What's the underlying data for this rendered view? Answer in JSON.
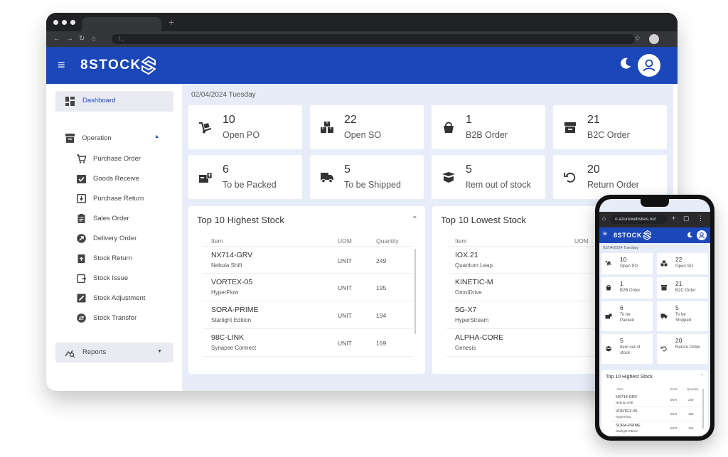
{
  "browser": {
    "url": "/..."
  },
  "app": {
    "brand": "8STOCK"
  },
  "sidebar": {
    "dashboard": "Dashboard",
    "operation": "Operation",
    "items": [
      {
        "label": "Purchase Order"
      },
      {
        "label": "Goods Receive"
      },
      {
        "label": "Purchase Return"
      },
      {
        "label": "Sales Order"
      },
      {
        "label": "Delivery Order"
      },
      {
        "label": "Stock Return"
      },
      {
        "label": "Stock Issue"
      },
      {
        "label": "Stock Adjustment"
      },
      {
        "label": "Stock Transfer"
      }
    ],
    "reports": "Reports"
  },
  "dashboard": {
    "date": "02/04/2024 Tuesday",
    "cards": [
      {
        "value": "10",
        "label": "Open PO"
      },
      {
        "value": "22",
        "label": "Open SO"
      },
      {
        "value": "1",
        "label": "B2B Order"
      },
      {
        "value": "21",
        "label": "B2C Order"
      },
      {
        "value": "6",
        "label": "To be Packed"
      },
      {
        "value": "5",
        "label": "To be Shipped"
      },
      {
        "value": "5",
        "label": "Item out of stock"
      },
      {
        "value": "20",
        "label": "Return Order"
      }
    ],
    "highest": {
      "title": "Top 10 Highest Stock",
      "headers": {
        "item": "Item",
        "uom": "UOM",
        "qty": "Quantity"
      },
      "rows": [
        {
          "item": "NX714-GRV",
          "sub": "Nebula Shift",
          "uom": "UNIT",
          "qty": "249"
        },
        {
          "item": "VORTEX-05",
          "sub": "HyperFlow",
          "uom": "UNIT",
          "qty": "195"
        },
        {
          "item": "SORA-PRIME",
          "sub": "Starlight Edition",
          "uom": "UNIT",
          "qty": "194"
        },
        {
          "item": "98C-LINK",
          "sub": "Synapse Connect",
          "uom": "UNIT",
          "qty": "169"
        }
      ]
    },
    "lowest": {
      "title": "Top 10 Lowest Stock",
      "headers": {
        "item": "Item",
        "uom": "UOM"
      },
      "rows": [
        {
          "item": "IOX.21",
          "sub": "Quantum Leap"
        },
        {
          "item": "KINETIC-M",
          "sub": "OmniDrive"
        },
        {
          "item": "5G-X7",
          "sub": "HyperStream"
        },
        {
          "item": "ALPHA-CORE",
          "sub": "Genesis"
        }
      ]
    }
  },
  "phone": {
    "url": "o.azurewebsites.net",
    "cards": [
      {
        "value": "10",
        "label": "Open PO"
      },
      {
        "value": "22",
        "label": "Open SO"
      },
      {
        "value": "1",
        "label": "B2B Order"
      },
      {
        "value": "21",
        "label": "B2C Order"
      },
      {
        "value": "6",
        "label": "To be Packed"
      },
      {
        "value": "5",
        "label": "To be Shipped"
      },
      {
        "value": "5",
        "label": "Item out of stock"
      },
      {
        "value": "20",
        "label": "Return Order"
      }
    ],
    "highest_rows": [
      {
        "item": "NX714-GRV",
        "sub": "Nebula Shift",
        "uom": "UNIT",
        "qty": "249"
      },
      {
        "item": "VORTEX-05",
        "sub": "HyperFlow",
        "uom": "UNIT",
        "qty": "195"
      },
      {
        "item": "SORA-PRIME",
        "sub": "Starlight Edition",
        "uom": "UNIT",
        "qty": "194"
      }
    ]
  },
  "colors": {
    "primary": "#1c47b8",
    "background": "#e7edf8",
    "sidebar_active": "#e9ebf1"
  },
  "icons": [
    "menu-icon",
    "logo-s-icon",
    "moon-icon",
    "user-icon",
    "dashboard-icon",
    "operation-icon",
    "cart-icon",
    "check-icon",
    "return-icon",
    "clipboard-icon",
    "delivery-icon",
    "stock-return-icon",
    "stock-issue-icon",
    "adjust-icon",
    "transfer-icon",
    "reports-icon",
    "chevron-up-icon",
    "chevron-down-icon"
  ]
}
